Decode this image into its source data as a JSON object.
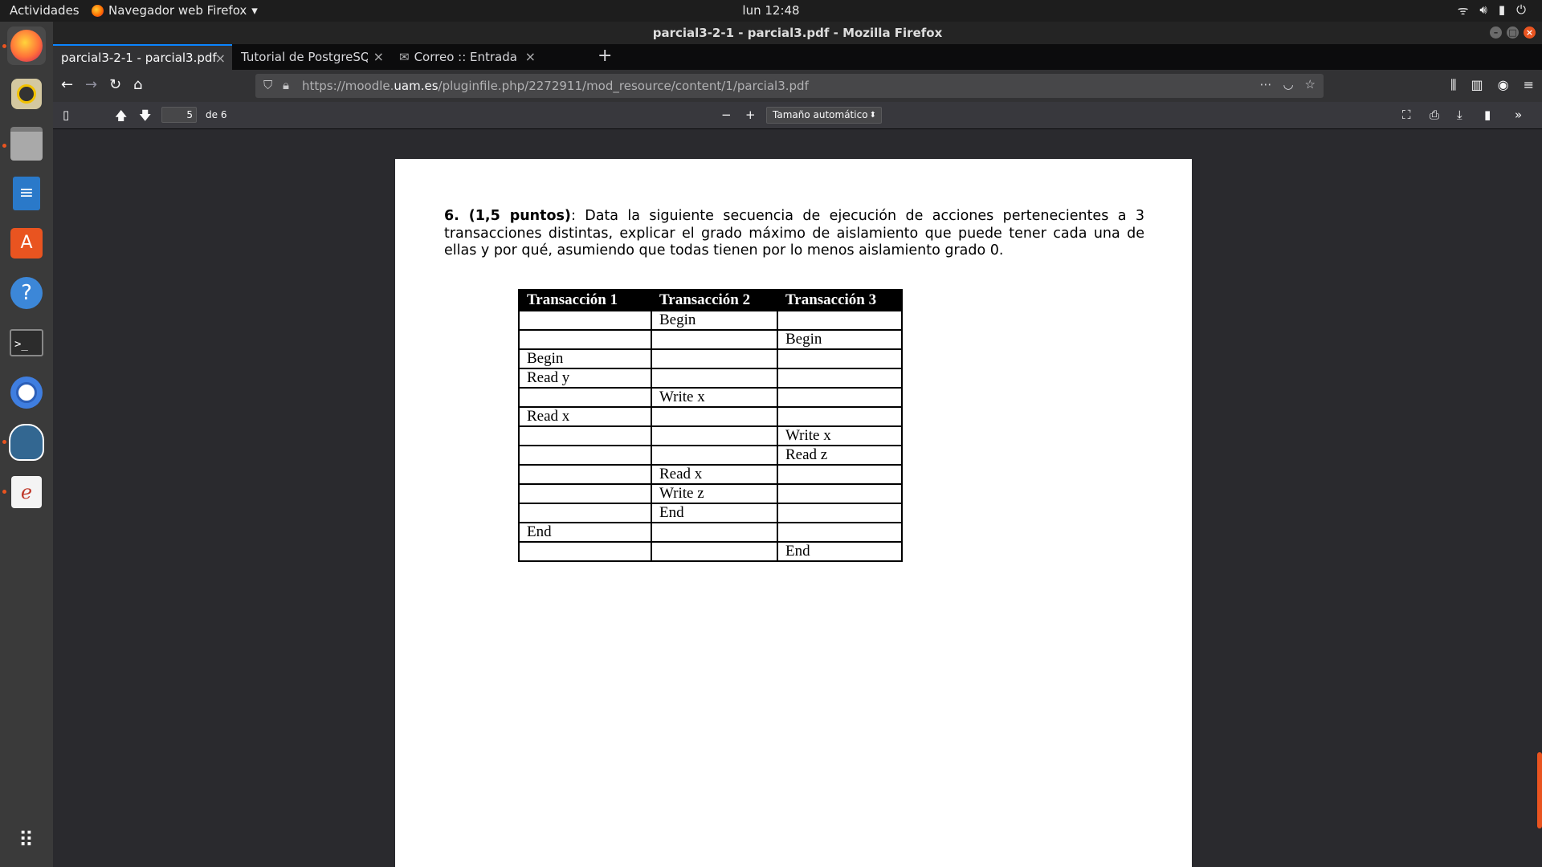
{
  "topbar": {
    "activities": "Actividades",
    "app_menu": "Navegador web Firefox",
    "clock": "lun 12:48",
    "tray_icons": [
      "wifi-icon",
      "volume-icon",
      "battery-icon",
      "power-icon"
    ]
  },
  "dock": {
    "items": [
      "firefox",
      "rhythmbox",
      "files",
      "libreoffice-writer",
      "ubuntu-software",
      "help",
      "terminal",
      "chromium",
      "pgadmin",
      "evince",
      "show-applications"
    ]
  },
  "window": {
    "title": "parcial3-2-1 - parcial3.pdf - Mozilla Firefox",
    "tabs": [
      {
        "label": "parcial3-2-1 - parcial3.pdf",
        "active": true
      },
      {
        "label": "Tutorial de PostgreSQL - Tip",
        "active": false
      },
      {
        "label": "Correo :: Entrada",
        "active": false
      }
    ],
    "url_prefix": "https://moodle.",
    "url_host": "uam.es",
    "url_path": "/pluginfile.php/2272911/mod_resource/content/1/parcial3.pdf"
  },
  "pdf": {
    "page_number": "5",
    "page_count": "de 6",
    "zoom": "Tamaño automático",
    "question_bold": "6. (1,5 puntos)",
    "question_text": ": Data la siguiente secuencia de ejecución de acciones pertenecientes a 3 transacciones distintas, explicar el grado máximo de aislamiento que puede tener cada una de ellas y por qué, asumiendo que todas tienen por lo menos aislamiento grado 0.",
    "table": {
      "headers": [
        "Transacción 1",
        "Transacción 2",
        "Transacción 3"
      ],
      "rows": [
        [
          "",
          "Begin",
          ""
        ],
        [
          "",
          "",
          "Begin"
        ],
        [
          "Begin",
          "",
          ""
        ],
        [
          "Read y",
          "",
          ""
        ],
        [
          "",
          "Write x",
          ""
        ],
        [
          "Read x",
          "",
          ""
        ],
        [
          "",
          "",
          "Write x"
        ],
        [
          "",
          "",
          "Read z"
        ],
        [
          "",
          "Read x",
          ""
        ],
        [
          "",
          "Write z",
          ""
        ],
        [
          "",
          "End",
          ""
        ],
        [
          "End",
          "",
          ""
        ],
        [
          "",
          "",
          "End"
        ]
      ]
    }
  },
  "colors": {
    "accent": "#0a84ff",
    "ubuntu_orange": "#e95420"
  }
}
